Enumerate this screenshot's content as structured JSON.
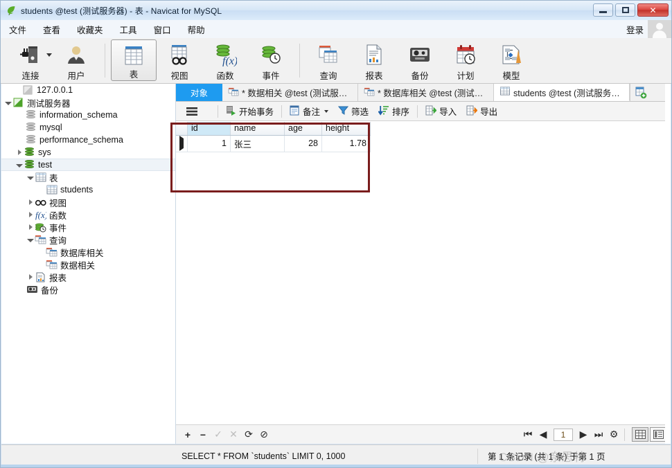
{
  "window": {
    "title": "students @test (测试服务器) - 表 - Navicat for MySQL",
    "app_icon": "navicat-leaf-icon",
    "minimize_label": "",
    "maximize_label": "",
    "close_label": "✕"
  },
  "menubar": {
    "items": [
      {
        "label": "文件",
        "name": "menu-file"
      },
      {
        "label": "查看",
        "name": "menu-view"
      },
      {
        "label": "收藏夹",
        "name": "menu-favorites"
      },
      {
        "label": "工具",
        "name": "menu-tools"
      },
      {
        "label": "窗口",
        "name": "menu-window"
      },
      {
        "label": "帮助",
        "name": "menu-help"
      }
    ],
    "login_label": "登录"
  },
  "ribbon": {
    "buttons": [
      {
        "label": "连接",
        "icon": "connection-icon",
        "selected": false,
        "has_dropdown": true
      },
      {
        "label": "用户",
        "icon": "user-icon",
        "selected": false,
        "has_dropdown": false
      },
      {
        "label": "表",
        "icon": "table-icon",
        "selected": true,
        "has_dropdown": false
      },
      {
        "label": "视图",
        "icon": "view-icon",
        "selected": false,
        "has_dropdown": false
      },
      {
        "label": "函数",
        "icon": "function-icon",
        "selected": false,
        "has_dropdown": false
      },
      {
        "label": "事件",
        "icon": "event-icon",
        "selected": false,
        "has_dropdown": false
      },
      {
        "label": "查询",
        "icon": "query-icon",
        "selected": false,
        "has_dropdown": false
      },
      {
        "label": "报表",
        "icon": "report-icon",
        "selected": false,
        "has_dropdown": false
      },
      {
        "label": "备份",
        "icon": "backup-icon",
        "selected": false,
        "has_dropdown": false
      },
      {
        "label": "计划",
        "icon": "schedule-icon",
        "selected": false,
        "has_dropdown": false
      },
      {
        "label": "模型",
        "icon": "model-icon",
        "selected": false,
        "has_dropdown": false
      }
    ]
  },
  "sidebar": {
    "nodes": [
      {
        "label": "127.0.0.1",
        "icon": "connection-gray-icon",
        "indent": 1,
        "twisty": "none",
        "selected": false
      },
      {
        "label": "测试服务器",
        "icon": "connection-green-icon",
        "indent": 0,
        "twisty": "open",
        "selected": false
      },
      {
        "label": "information_schema",
        "icon": "database-gray-icon",
        "indent": 2,
        "twisty": "none",
        "selected": false
      },
      {
        "label": "mysql",
        "icon": "database-gray-icon",
        "indent": 2,
        "twisty": "none",
        "selected": false
      },
      {
        "label": "performance_schema",
        "icon": "database-gray-icon",
        "indent": 2,
        "twisty": "none",
        "selected": false
      },
      {
        "label": "sys",
        "icon": "database-green-icon",
        "indent": 1,
        "twisty": "closed",
        "selected": false
      },
      {
        "label": "test",
        "icon": "database-green-icon",
        "indent": 1,
        "twisty": "open",
        "selected": true
      },
      {
        "label": "表",
        "icon": "table-folder-icon",
        "indent": 2,
        "twisty": "open",
        "selected": false
      },
      {
        "label": "students",
        "icon": "table-item-icon",
        "indent": 4,
        "twisty": "none",
        "selected": false
      },
      {
        "label": "视图",
        "icon": "view-folder-icon",
        "indent": 2,
        "twisty": "closed",
        "selected": false
      },
      {
        "label": "函数",
        "icon": "function-folder-icon",
        "indent": 2,
        "twisty": "closed",
        "selected": false
      },
      {
        "label": "事件",
        "icon": "event-folder-icon",
        "indent": 2,
        "twisty": "closed",
        "selected": false
      },
      {
        "label": "查询",
        "icon": "query-folder-icon",
        "indent": 2,
        "twisty": "open",
        "selected": false
      },
      {
        "label": "数据库相关",
        "icon": "query-item-icon",
        "indent": 4,
        "twisty": "none",
        "selected": false
      },
      {
        "label": "数据相关",
        "icon": "query-item-icon",
        "indent": 4,
        "twisty": "none",
        "selected": false
      },
      {
        "label": "报表",
        "icon": "report-folder-icon",
        "indent": 2,
        "twisty": "closed",
        "selected": false
      },
      {
        "label": "备份",
        "icon": "backup-folder-icon",
        "indent": 2,
        "twisty": "none",
        "selected": false
      }
    ]
  },
  "tabs": {
    "object_tab_label": "对象",
    "items": [
      {
        "label": "* 数据相关 @test (测试服务器...",
        "icon": "query-tab-icon",
        "active": false
      },
      {
        "label": "* 数据库相关 @test (测试服务...",
        "icon": "query-tab-icon",
        "active": false
      },
      {
        "label": "students @test (测试服务器) ...",
        "icon": "table-tab-icon",
        "active": true
      }
    ],
    "add_tab_icon": "new-tab-icon"
  },
  "gridbar": {
    "menu_icon": "hamburger-icon",
    "buttons": [
      {
        "label": "开始事务",
        "icon": "transaction-icon",
        "dropdown": false
      },
      {
        "label": "备注",
        "icon": "note-icon",
        "dropdown": true
      },
      {
        "label": "筛选",
        "icon": "filter-icon",
        "dropdown": false
      },
      {
        "label": "排序",
        "icon": "sort-icon",
        "dropdown": false
      },
      {
        "label": "导入",
        "icon": "import-icon",
        "dropdown": false
      },
      {
        "label": "导出",
        "icon": "export-icon",
        "dropdown": false
      }
    ]
  },
  "grid": {
    "columns": [
      "id",
      "name",
      "age",
      "height"
    ],
    "selected_column": "id",
    "rows": [
      {
        "marker": "current-row-marker",
        "id": "1",
        "name": "张三",
        "age": "28",
        "height": "1.78"
      }
    ],
    "selected_cell": {
      "row": 0,
      "column": "id"
    }
  },
  "gridnav": {
    "add_label": "+",
    "remove_label": "−",
    "confirm_label": "✓",
    "cancel_label": "✕",
    "refresh_label": "⟳",
    "stop_label": "⊘",
    "first_label": "⏮",
    "prev_label": "◀",
    "page_value": "1",
    "next_label": "▶",
    "last_label": "⏭",
    "settings_label": "⚙",
    "view_grid_icon": "grid-view-icon",
    "view_form_icon": "form-view-icon"
  },
  "statusbar": {
    "sql": "SELECT * FROM `students` LIMIT 0, 1000",
    "record_info": "第 1 条记录 (共 1 条) 于第 1 页",
    "watermark": "CSDN @奈思特"
  },
  "colors": {
    "accent_blue": "#1e9bf0",
    "selection_blue": "#3d9bea",
    "highlight_red": "#7a1d1d",
    "db_green": "#5aa832",
    "header_blue": "#cfe9f7"
  }
}
